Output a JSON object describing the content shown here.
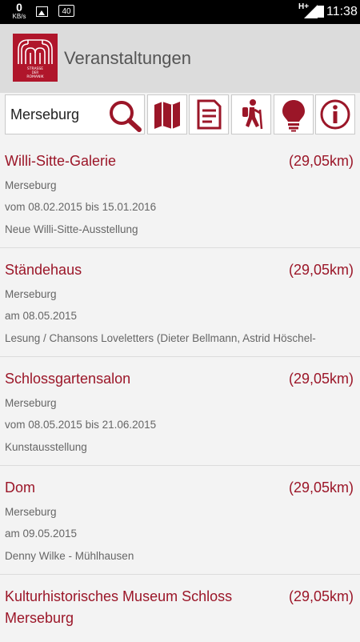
{
  "status": {
    "speed_value": "0",
    "speed_unit": "KB/s",
    "battery_label": "40",
    "network": "H+",
    "time": "11:38"
  },
  "header": {
    "title": "Veranstaltungen",
    "logo_text": "STRASSE DER ROMANIK"
  },
  "search": {
    "value": "Merseburg",
    "placeholder": ""
  },
  "toolbar": {
    "tools": [
      "map-icon",
      "document-icon",
      "hiker-icon",
      "lightbulb-icon",
      "info-icon"
    ]
  },
  "events": [
    {
      "title": "Willi-Sitte-Galerie",
      "distance": "(29,05km)",
      "city": "Merseburg",
      "date": "vom 08.02.2015 bis 15.01.2016",
      "description": "Neue Willi-Sitte-Ausstellung"
    },
    {
      "title": "Ständehaus",
      "distance": "(29,05km)",
      "city": "Merseburg",
      "date": "am 08.05.2015",
      "description": "Lesung / Chansons Loveletters (Dieter Bellmann, Astrid Höschel-"
    },
    {
      "title": "Schlossgartensalon",
      "distance": "(29,05km)",
      "city": "Merseburg",
      "date": "vom 08.05.2015 bis 21.06.2015",
      "description": "Kunstausstellung"
    },
    {
      "title": "Dom",
      "distance": "(29,05km)",
      "city": "Merseburg",
      "date": "am 09.05.2015",
      "description": "Denny Wilke - Mühlhausen"
    },
    {
      "title": "Kulturhistorisches Museum Schloss Merseburg",
      "distance": "(29,05km)",
      "city": "Merseburg",
      "date": "",
      "description": ""
    }
  ],
  "colors": {
    "accent": "#9b1628",
    "logo_bg": "#b0162b",
    "appbar_bg": "#dcdcdc",
    "page_bg": "#f3f3f3"
  }
}
